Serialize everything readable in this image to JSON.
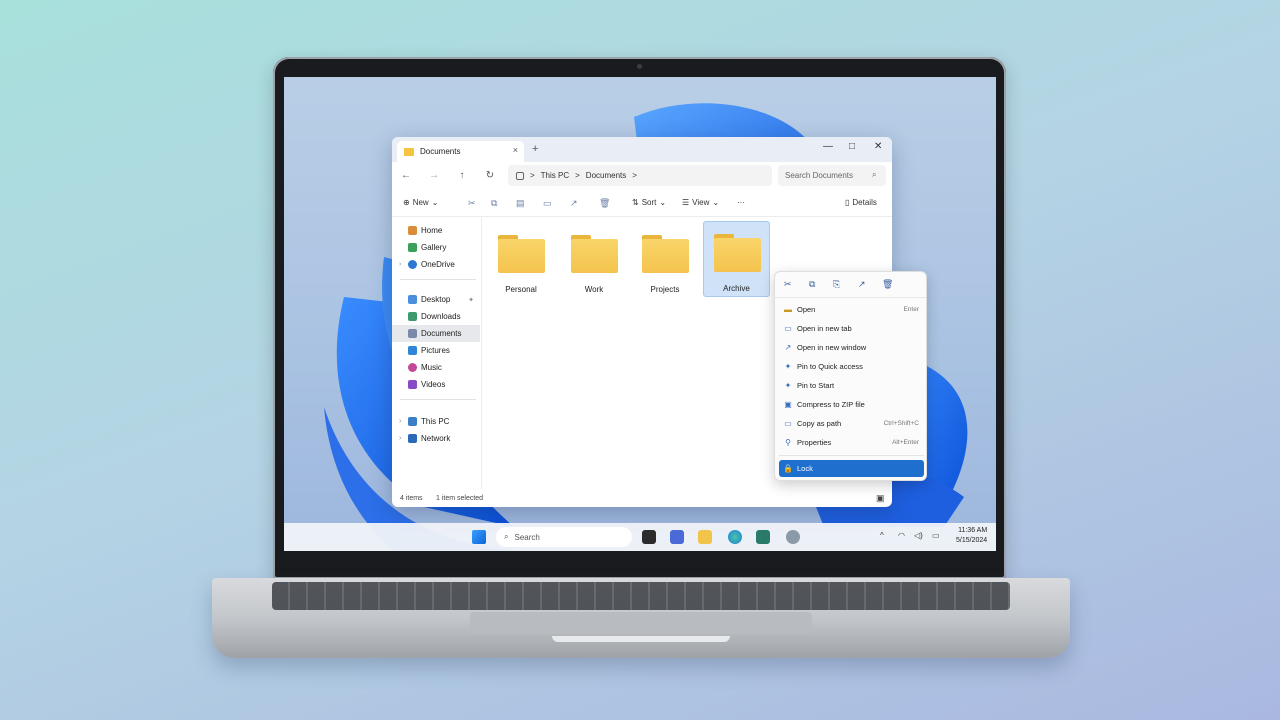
{
  "window": {
    "tab_title": "Documents",
    "tab_close": "×",
    "new_tab": "+",
    "controls": [
      "—",
      "□",
      "✕"
    ]
  },
  "nav": {
    "back": "←",
    "forward": "→",
    "up": "↑",
    "refresh": "↻",
    "breadcrumb": [
      "This PC",
      "Documents"
    ],
    "separator": ">",
    "search_placeholder": "Search Documents",
    "search_icon": "⌕"
  },
  "toolbar": {
    "new_label": "New",
    "sort_label": "Sort",
    "view_label": "View",
    "more_label": "···",
    "details_label": "Details",
    "caret": "⌄"
  },
  "sidebar": {
    "items": [
      {
        "label": "Home",
        "icon": "home-icon"
      },
      {
        "label": "Gallery",
        "icon": "gallery-icon"
      },
      {
        "label": "OneDrive",
        "icon": "cloud-icon"
      },
      {
        "label": "Desktop",
        "icon": "desktop-icon"
      },
      {
        "label": "Downloads",
        "icon": "download-icon"
      },
      {
        "label": "Documents",
        "icon": "document-icon"
      },
      {
        "label": "Pictures",
        "icon": "picture-icon"
      },
      {
        "label": "Music",
        "icon": "music-icon"
      },
      {
        "label": "Videos",
        "icon": "video-icon"
      },
      {
        "label": "This PC",
        "icon": "computer-icon"
      },
      {
        "label": "Network",
        "icon": "network-icon"
      }
    ]
  },
  "folders": [
    "Personal",
    "Work",
    "Projects",
    "Archive"
  ],
  "status": {
    "count": "4 items",
    "selected": "1 item selected"
  },
  "context_menu": {
    "quick_actions": [
      "✂",
      "⧉",
      "⎘",
      "↗",
      "🗑"
    ],
    "items": [
      {
        "label": "Open",
        "shortcut": "Enter",
        "icon": "open-icon",
        "glyph": "▬"
      },
      {
        "label": "Open in new tab",
        "shortcut": "",
        "icon": "new-tab-icon",
        "glyph": "▭"
      },
      {
        "label": "Open in new window",
        "shortcut": "",
        "icon": "new-window-icon",
        "glyph": "↗"
      },
      {
        "label": "Pin to Quick access",
        "shortcut": "",
        "icon": "pin-icon",
        "glyph": "✦"
      },
      {
        "label": "Pin to Start",
        "shortcut": "",
        "icon": "pin-start-icon",
        "glyph": "✦"
      },
      {
        "label": "Compress to ZIP file",
        "shortcut": "",
        "icon": "zip-icon",
        "glyph": "▣"
      },
      {
        "label": "Copy as path",
        "shortcut": "Ctrl+Shift+C",
        "icon": "copy-path-icon",
        "glyph": "▭"
      },
      {
        "label": "Properties",
        "shortcut": "Alt+Enter",
        "icon": "properties-icon",
        "glyph": "⚲"
      }
    ],
    "highlight": {
      "label": "Lock",
      "icon": "lock-icon",
      "glyph": "🔒"
    }
  },
  "taskbar": {
    "search_label": "Search",
    "search_icon": "⌕",
    "tray": {
      "chevron": "^",
      "wifi": "◠",
      "volume": "◁)",
      "battery": "▭"
    },
    "time": "11:36 AM",
    "date": "5/15/2024"
  },
  "colors": {
    "accent": "#1f6fce",
    "folder": "#f4c34d",
    "selection": "#cfe2f7"
  }
}
